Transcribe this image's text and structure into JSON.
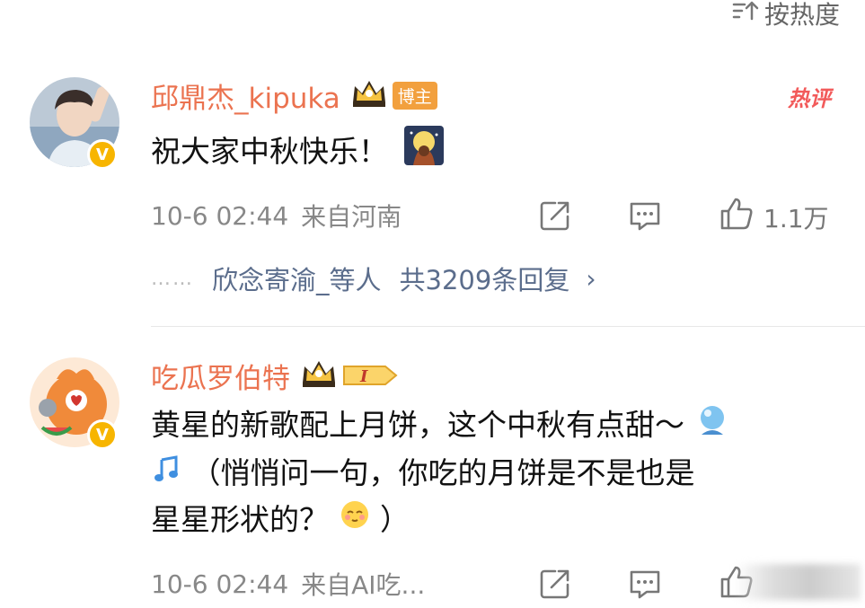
{
  "sort": {
    "label": "按热度"
  },
  "comments": [
    {
      "username": "邱鼎杰_kipuka",
      "role_badge": "博主",
      "hot_tag": "热评",
      "text": "祝大家中秋快乐！",
      "time": "10-6 02:44",
      "source": "来自河南",
      "likes": "1.1万",
      "verified_badge": "V",
      "replies": {
        "dots": "……",
        "names": "欣念寄渝_等人",
        "count": "共3209条回复",
        "chevron": "›"
      }
    },
    {
      "username": "吃瓜罗伯特",
      "level_badge": "I",
      "text_line1": "黄星的新歌配上月饼，这个中秋有点甜～",
      "text_line2": "（悄悄问一句，你吃的月饼是不是也是",
      "text_line3": "星星形状的？",
      "text_tail": "）",
      "time": "10-6 02:44",
      "source": "来自AI吃...",
      "verified_badge": "V"
    }
  ],
  "icons": {
    "sort": "sort-icon",
    "share": "share-icon",
    "comment": "comment-icon",
    "like": "thumbs-up-icon",
    "crown": "crown-icon",
    "moon_emoji": "moon-emoji",
    "music": "music-note-icon",
    "shy": "shy-face-emoji"
  },
  "colors": {
    "username": "#eb7350",
    "reply_link": "#5b6d8c",
    "meta": "#888888",
    "hot": "#f25a5a",
    "verified": "#f7b500"
  }
}
